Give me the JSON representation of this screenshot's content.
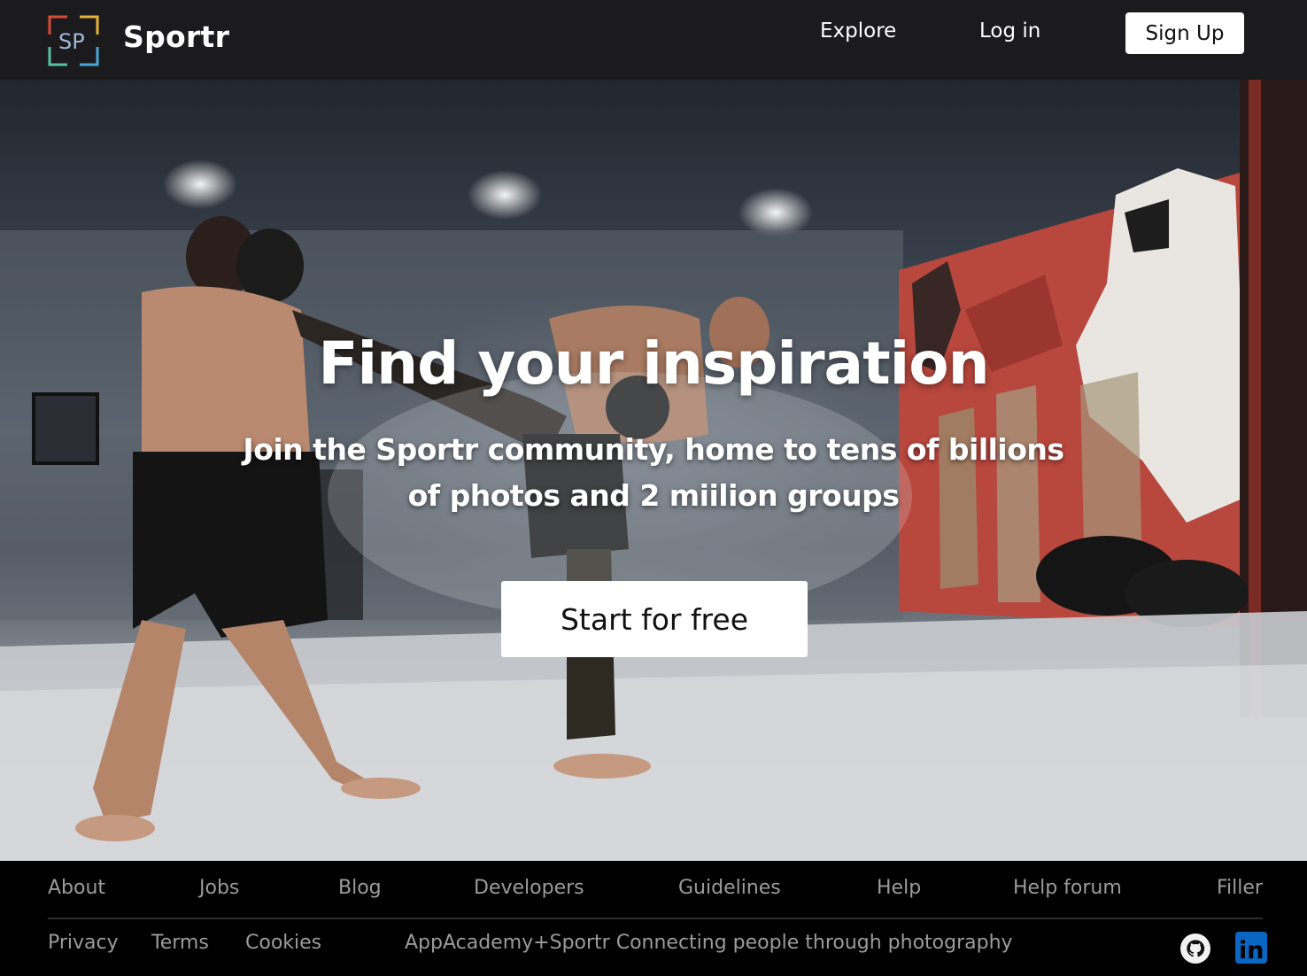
{
  "header": {
    "brand": "Sportr",
    "logo_letters": "SP",
    "nav": {
      "explore": "Explore",
      "login": "Log in",
      "signup": "Sign Up"
    }
  },
  "hero": {
    "title": "Find your inspiration",
    "subtitle": "Join the Sportr community, home to tens of billions of photos and 2 miilion groups",
    "cta": "Start for free"
  },
  "footer": {
    "links_row1": [
      "About",
      "Jobs",
      "Blog",
      "Developers",
      "Guidelines",
      "Help",
      "Help forum",
      "Filler"
    ],
    "links_row2": [
      "Privacy",
      "Terms",
      "Cookies"
    ],
    "tagline": "AppAcademy+Sportr Connecting people through photography",
    "icons": [
      "github-icon",
      "linkedin-icon"
    ],
    "linkedin_label": "in"
  },
  "colors": {
    "header_bg": "#1b1b1d",
    "footer_bg": "#000000",
    "footer_text": "#9b9b9b",
    "linkedin": "#0a66c2",
    "mural_red": "#c84a3e"
  }
}
